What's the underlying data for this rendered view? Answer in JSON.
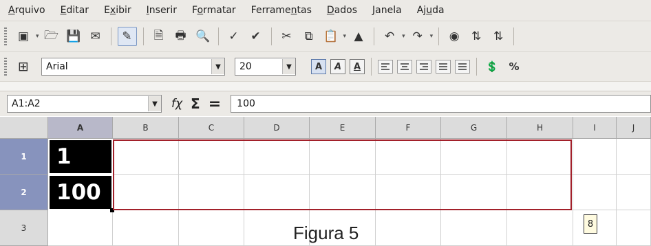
{
  "menubar": {
    "items": [
      {
        "before": "",
        "accel": "A",
        "after": "rquivo"
      },
      {
        "before": "",
        "accel": "E",
        "after": "ditar"
      },
      {
        "before": "E",
        "accel": "x",
        "after": "ibir"
      },
      {
        "before": "",
        "accel": "I",
        "after": "nserir"
      },
      {
        "before": "F",
        "accel": "o",
        "after": "rmatar"
      },
      {
        "before": "Ferrame",
        "accel": "n",
        "after": "tas"
      },
      {
        "before": "",
        "accel": "D",
        "after": "ados"
      },
      {
        "before": "",
        "accel": "J",
        "after": "anela"
      },
      {
        "before": "Aj",
        "accel": "u",
        "after": "da"
      }
    ]
  },
  "toolbar_standard": {
    "icons": [
      "new-document-icon",
      "open-folder-icon",
      "save-icon",
      "email-icon",
      "edit-mode-icon",
      "export-pdf-icon",
      "print-icon",
      "print-preview-icon",
      "spellcheck-icon",
      "autospellcheck-icon",
      "cut-icon",
      "copy-icon",
      "paste-icon",
      "format-paintbrush-icon",
      "undo-icon",
      "redo-icon",
      "navigator-icon",
      "sort-ascending-icon",
      "sort-descending-icon"
    ]
  },
  "toolbar_format": {
    "font_name": "Arial",
    "font_size": "20",
    "bold_label": "A",
    "italic_label": "A",
    "underline_label": "A",
    "percent_label": "%"
  },
  "formula_bar": {
    "name_box": "A1:A2",
    "function_wizard": "fχ",
    "sum_symbol": "Σ",
    "equals_symbol": "=",
    "content": "100"
  },
  "sheet": {
    "columns": [
      "A",
      "B",
      "C",
      "D",
      "E",
      "F",
      "G",
      "H",
      "I",
      "J"
    ],
    "rows": [
      "1",
      "2",
      "3"
    ],
    "cells": {
      "A1": "1",
      "A2": "100"
    }
  },
  "autofill_tip": "8",
  "caption": "Figura 5"
}
